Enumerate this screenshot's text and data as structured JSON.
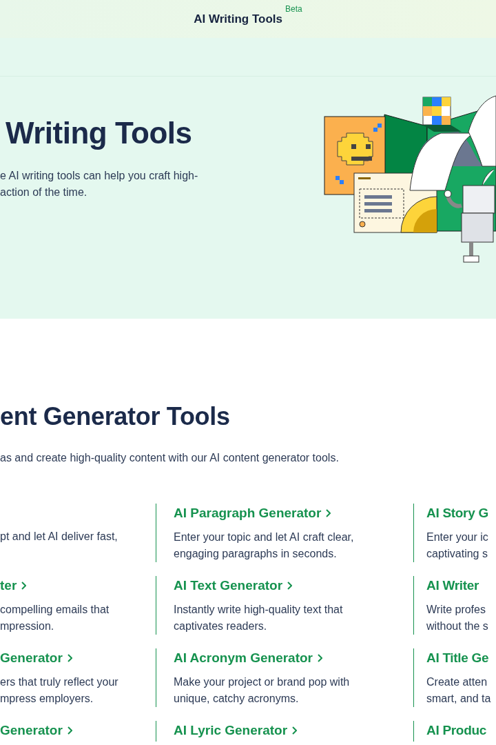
{
  "header": {
    "title": "AI Writing Tools",
    "badge": "Beta"
  },
  "hero": {
    "title": "Writing Tools",
    "description": "e AI writing tools can help you craft high-action of the time."
  },
  "section": {
    "title": "ent Generator Tools",
    "subtitle": "as and create high-quality content with our AI content generator tools.",
    "tool_rows": [
      [
        {
          "description": "pt and let AI deliver fast,"
        },
        {
          "title": "AI Paragraph Generator",
          "chevron": true,
          "description": "Enter your topic and let AI craft clear, engaging paragraphs in seconds."
        },
        {
          "title": "AI Story G",
          "chevron": false,
          "description": "Enter your ic captivating s"
        }
      ],
      [
        {
          "title": "ter",
          "chevron": true,
          "description": "compelling emails that mpression."
        },
        {
          "title": "AI Text Generator",
          "chevron": true,
          "description": "Instantly write high-quality text that captivates readers."
        },
        {
          "title": "AI Writer",
          "chevron": false,
          "description": "Write profes without the s"
        }
      ],
      [
        {
          "title": "Generator",
          "chevron": true,
          "description": "ers that truly reflect your mpress employers."
        },
        {
          "title": "AI Acronym Generator",
          "chevron": true,
          "description": "Make your project or brand pop with unique, catchy acronyms."
        },
        {
          "title": "AI Title Ge",
          "chevron": false,
          "description": "Create atten smart, and ta"
        }
      ],
      [
        {
          "title": "Generator",
          "chevron": true
        },
        {
          "title": "AI Lyric Generator",
          "chevron": true
        },
        {
          "title": "AI Produc",
          "chevron": false
        }
      ]
    ]
  }
}
